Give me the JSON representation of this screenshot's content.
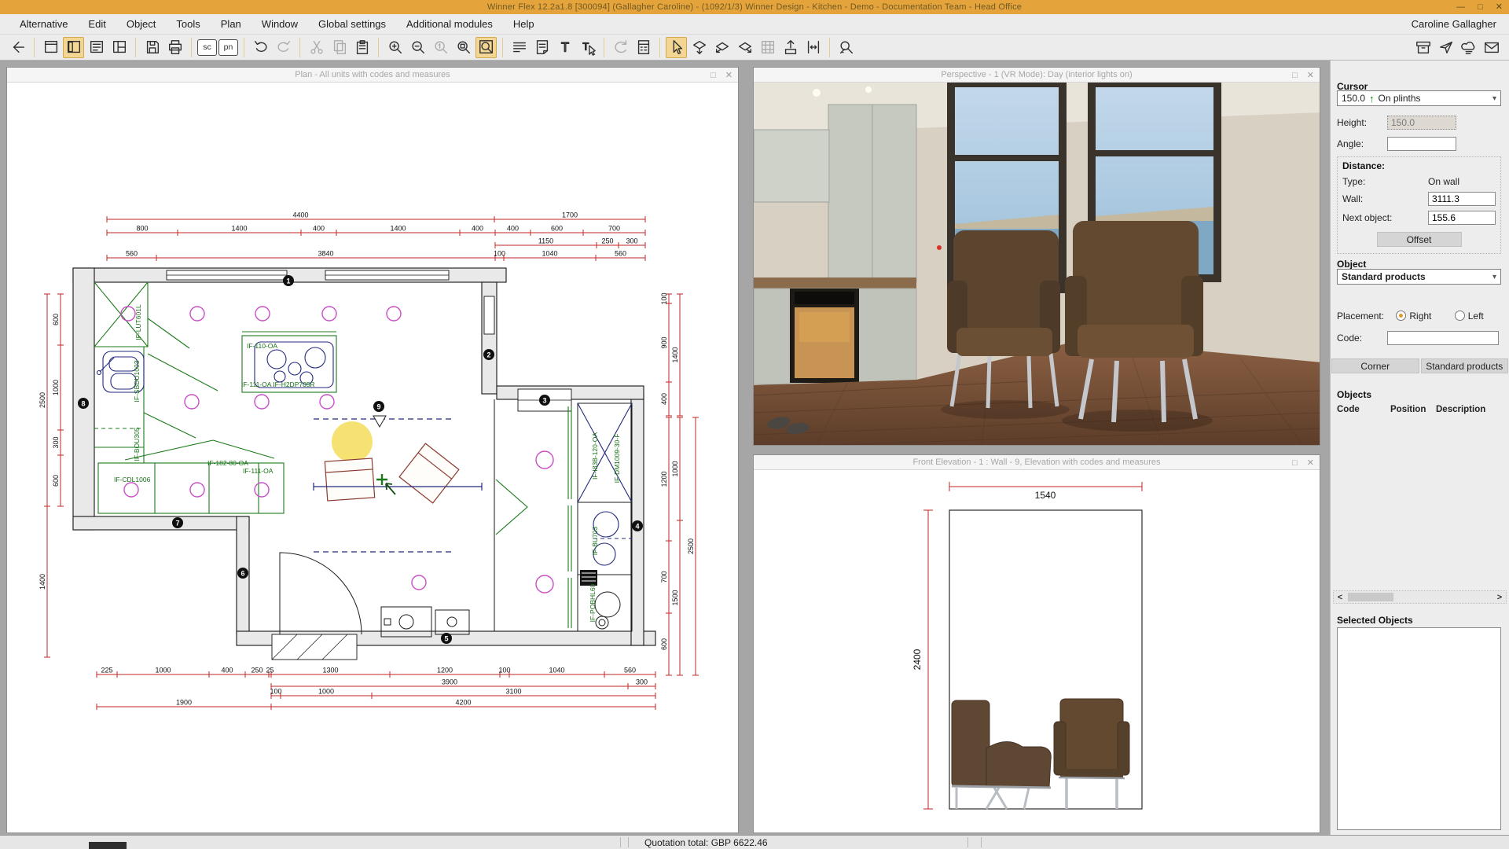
{
  "window": {
    "title": "Winner Flex 12.2a1.8  [300094]  (Gallagher Caroline) - (1092/1/3) Winner Design - Kitchen - Demo - Documentation Team - Head Office",
    "controls": {
      "minimize": "—",
      "maximize": "□",
      "close": "✕"
    }
  },
  "menubar": {
    "items": [
      "Alternative",
      "Edit",
      "Object",
      "Tools",
      "Plan",
      "Window",
      "Global settings",
      "Additional modules",
      "Help"
    ],
    "user": "Caroline Gallagher"
  },
  "toolbar": {
    "groups": [
      [
        {
          "name": "back-button",
          "icon": "arrow-left"
        }
      ],
      [
        {
          "name": "plan-window-button",
          "icon": "win-plan"
        },
        {
          "name": "item-catalog-button",
          "icon": "win-catalog",
          "state": "active"
        },
        {
          "name": "unit-list-button",
          "icon": "win-list"
        },
        {
          "name": "elevation-window-button",
          "icon": "win-elev"
        }
      ],
      [
        {
          "name": "save-button",
          "icon": "floppy"
        },
        {
          "name": "print-button",
          "icon": "printer"
        }
      ],
      [
        {
          "name": "sc-button",
          "text": "sc"
        },
        {
          "name": "pn-button",
          "text": "pn"
        }
      ],
      [
        {
          "name": "undo-button",
          "icon": "undo"
        },
        {
          "name": "redo-button",
          "icon": "redo",
          "state": "disabled"
        }
      ],
      [
        {
          "name": "cut-button",
          "icon": "scissors",
          "state": "disabled"
        },
        {
          "name": "copy-button",
          "icon": "copy",
          "state": "disabled"
        },
        {
          "name": "paste-button",
          "icon": "clipboard"
        }
      ],
      [
        {
          "name": "zoom-in-button",
          "icon": "mag-plus"
        },
        {
          "name": "zoom-out-button",
          "icon": "mag-minus"
        },
        {
          "name": "zoom-previous-button",
          "icon": "mag-1",
          "state": "disabled"
        },
        {
          "name": "zoom-window-button",
          "icon": "mag-win"
        },
        {
          "name": "zoom-all-button",
          "icon": "mag-page",
          "state": "active"
        }
      ],
      [
        {
          "name": "view-text-button",
          "icon": "doc-lines"
        },
        {
          "name": "note-button",
          "icon": "note"
        },
        {
          "name": "text-button",
          "icon": "text-t"
        },
        {
          "name": "select-text-button",
          "icon": "text-cursor"
        }
      ],
      [
        {
          "name": "refresh-button",
          "icon": "refresh",
          "state": "disabled"
        },
        {
          "name": "calculate-button",
          "icon": "calc"
        }
      ],
      [
        {
          "name": "pointer-button",
          "icon": "pointer",
          "state": "active"
        },
        {
          "name": "move-object-button",
          "icon": "push-1"
        },
        {
          "name": "rotate-object-button",
          "icon": "push-2"
        },
        {
          "name": "push-object-button",
          "icon": "push-3"
        },
        {
          "name": "grid-button",
          "icon": "grid",
          "state": "disabled"
        },
        {
          "name": "lift-object-button",
          "icon": "lift"
        },
        {
          "name": "spread-objects-button",
          "icon": "spread"
        }
      ],
      [
        {
          "name": "measure-button",
          "icon": "measure"
        }
      ]
    ],
    "right_icons": [
      {
        "name": "archive-button",
        "icon": "archive"
      },
      {
        "name": "send-button",
        "icon": "send"
      },
      {
        "name": "cloud-print-button",
        "icon": "cloudprint"
      },
      {
        "name": "mail-button",
        "icon": "mail"
      }
    ],
    "sc_label": "sc",
    "pn_label": "pn"
  },
  "panels": {
    "plan_title": "Plan - All units with codes and measures",
    "perspective_title": "Perspective - 1 (VR Mode): Day (interior lights on)",
    "elevation_title": "Front Elevation - 1 : Wall - 9, Elevation with codes and measures",
    "maximize": "□",
    "close": "✕"
  },
  "plan": {
    "dims": {
      "top1": [
        "4400",
        "1700"
      ],
      "top2": [
        "800",
        "1400",
        "400",
        "1400",
        "400",
        "400",
        "600",
        "700"
      ],
      "top3": [
        "1150",
        "250",
        "300"
      ],
      "top4": [
        "560",
        "3840",
        "100",
        "1040",
        "560"
      ],
      "bottom1": [
        "225",
        "1000",
        "400",
        "250",
        "25",
        "1300",
        "1200",
        "100",
        "1040",
        "560"
      ],
      "bottom2": [
        "3900",
        "300"
      ],
      "bottom3": [
        "100",
        "1000",
        "3100"
      ],
      "bottom4": [
        "1900",
        "4200"
      ],
      "left_inner": [
        "600",
        "1000",
        "300",
        "600"
      ],
      "left_outer": [
        "2500",
        "1400"
      ],
      "right_top_inner": [
        "100",
        "900",
        "400"
      ],
      "right_top_outer": [
        "1400"
      ],
      "right_low_1": [
        "1200",
        "700",
        "600"
      ],
      "right_low_2": [
        "1000",
        "1500"
      ],
      "right_low_3": [
        "2500"
      ]
    },
    "codes": {
      "lut": "IF-LUT601L",
      "sink": "IF-SBDU1003",
      "bou": "IF-BOU305",
      "cdl": "IF-CDL1006",
      "c182": "IF-182-80-OA",
      "c111b": "IF-111-OA",
      "hob_top": "IF-110-OA",
      "hob_bottom": "IF-111-OA  IF-H2DP705R",
      "tall": "IF-I83B-120-OA",
      "dm": "IF-DM1009-30-F",
      "bu": "IF-BU703",
      "pob": "IF-POBHL60"
    },
    "wall_numbers": [
      "1",
      "2",
      "3",
      "4",
      "5",
      "6",
      "7",
      "8",
      "9"
    ]
  },
  "elevation": {
    "width_mm": "1540",
    "height_mm": "2400"
  },
  "sidebar": {
    "cursor_label": "Cursor",
    "cursor_value": "150.0",
    "cursor_arrow": "↑",
    "cursor_mode": "On plinths",
    "height_label": "Height:",
    "height_value": "150.0",
    "angle_label": "Angle:",
    "angle_value": "",
    "distance_label": "Distance:",
    "type_label": "Type:",
    "type_value": "On wall",
    "wall_label": "Wall:",
    "wall_value": "3111.3",
    "next_object_label": "Next object:",
    "next_object_value": "155.6",
    "offset_button": "Offset",
    "object_label": "Object",
    "object_value": "Standard products",
    "placement_label": "Placement:",
    "placement_right": "Right",
    "placement_left": "Left",
    "code_label": "Code:",
    "code_value": "",
    "corner_button": "Corner",
    "standard_products_button": "Standard products",
    "objects_label": "Objects",
    "objects_columns": [
      "Code",
      "Position",
      "Description"
    ],
    "selected_objects_label": "Selected Objects"
  },
  "statusbar": {
    "quotation": "Quotation total: GBP 6622.46"
  }
}
